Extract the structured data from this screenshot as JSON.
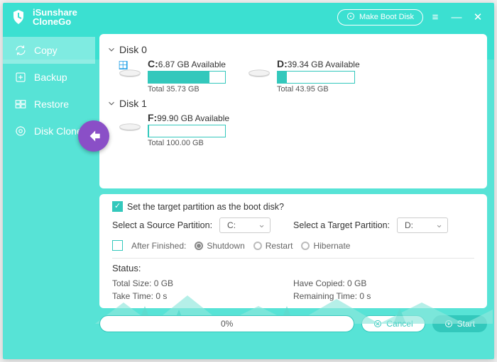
{
  "brand": {
    "line1": "iSunshare",
    "line2": "CloneGo"
  },
  "titlebar": {
    "make_boot": "Make Boot Disk"
  },
  "sidebar": {
    "items": [
      {
        "label": "Copy"
      },
      {
        "label": "Backup"
      },
      {
        "label": "Restore"
      },
      {
        "label": "Disk Clone"
      }
    ]
  },
  "disks": [
    {
      "name": "Disk 0",
      "partitions": [
        {
          "letter": "C:",
          "available": "6.87 GB Available",
          "fill_pct": 80,
          "total": "Total 35.73 GB",
          "os_icon": true
        },
        {
          "letter": "D:",
          "available": "39.34 GB Available",
          "fill_pct": 12,
          "total": "Total 43.95 GB",
          "os_icon": false
        }
      ]
    },
    {
      "name": "Disk 1",
      "partitions": [
        {
          "letter": "F:",
          "available": "99.90 GB Available",
          "fill_pct": 1,
          "total": "Total 100.00 GB",
          "os_icon": false
        }
      ]
    }
  ],
  "settings": {
    "boot_checkbox_label": "Set the target partition as the boot disk?",
    "boot_checked": true,
    "source_label": "Select a Source Partition:",
    "source_value": "C:",
    "target_label": "Select a Target Partition:",
    "target_value": "D:",
    "after_label": "After Finished:",
    "after_checked": false,
    "after_options": [
      "Shutdown",
      "Restart",
      "Hibernate"
    ],
    "after_selected": 0
  },
  "status": {
    "title": "Status:",
    "total_size": "Total Size: 0 GB",
    "have_copied": "Have Copied: 0 GB",
    "take_time": "Take Time: 0 s",
    "remaining": "Remaining Time: 0 s"
  },
  "footer": {
    "progress_pct": "0%",
    "cancel": "Cancel",
    "start": "Start"
  },
  "colors": {
    "accent": "#33c8bc",
    "badge": "#8a4fc7"
  }
}
